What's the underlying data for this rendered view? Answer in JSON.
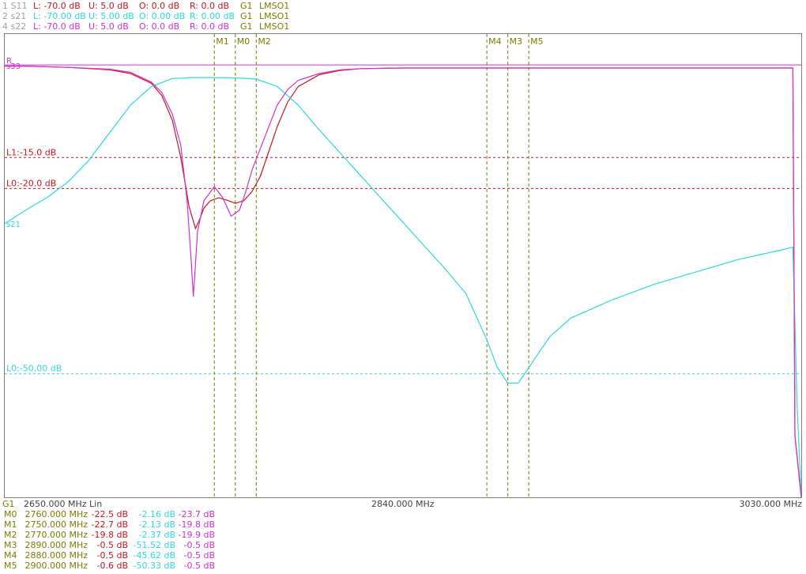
{
  "colors": {
    "s11": "#c8161d",
    "s21": "#33d6d9",
    "s22": "#cc33cc",
    "olive": "#7b7b00",
    "dim": "#a0a0a0",
    "axis_text": "#404040"
  },
  "header_rows": [
    {
      "id": "1 S11",
      "L": "L: -70.0 dB",
      "U": "U:  5.0 dB",
      "O": "O:  0.0 dB",
      "R": "R:  0.0 dB",
      "G": "G1",
      "lms": "LMSO1",
      "color": "#c8161d"
    },
    {
      "id": "2 s21",
      "L": "L: -70.00 dB",
      "U": "U:  5.00 dB",
      "O": "O:  0.00 dB",
      "R": "R:  0.00 dB",
      "G": "G1",
      "lms": "LMSO1",
      "color": "#33d6d9"
    },
    {
      "id": "4 s22",
      "L": "L: -70.0 dB",
      "U": "U:  5.0 dB",
      "O": "O:  0.0 dB",
      "R": "R:  0.0 dB",
      "G": "G1",
      "lms": "LMSO1",
      "color": "#cc33cc"
    }
  ],
  "plot_labels": {
    "ref_r": "R",
    "ref_s": "s33",
    "trace_label_s21": "s21"
  },
  "limit_lines": [
    {
      "label": "L1:-15.0 dB",
      "value_db": -15.0,
      "trace": "s11"
    },
    {
      "label": "L0:-20.0 dB",
      "value_db": -20.0,
      "trace": "s11"
    },
    {
      "label": "L0:-50.00 dB",
      "value_db": -50.0,
      "trace": "s21"
    }
  ],
  "x_axis": {
    "gate": "G1",
    "start_label": "2650.000 MHz Lin",
    "center_label": "2840.000 MHz",
    "stop_label": "3030.000 MHz",
    "start_mhz": 2650,
    "stop_mhz": 3030
  },
  "marker_table": [
    {
      "name": "M0",
      "freq": "2760.000 MHz",
      "s11": "-22.5 dB",
      "s21": "-2.16  dB",
      "s22": "-23.7 dB"
    },
    {
      "name": "M1",
      "freq": "2750.000 MHz",
      "s11": "-22.7 dB",
      "s21": "-2.13  dB",
      "s22": "-19.8 dB"
    },
    {
      "name": "M2",
      "freq": "2770.000 MHz",
      "s11": "-19.8 dB",
      "s21": "-2.37  dB",
      "s22": "-19.9 dB"
    },
    {
      "name": "M3",
      "freq": "2890.000 MHz",
      "s11": "-0.5 dB",
      "s21": "-51.52  dB",
      "s22": "-0.5 dB"
    },
    {
      "name": "M4",
      "freq": "2880.000 MHz",
      "s11": "-0.5 dB",
      "s21": "-45.62  dB",
      "s22": "-0.5 dB"
    },
    {
      "name": "M5",
      "freq": "2900.000 MHz",
      "s11": "-0.6 dB",
      "s21": "-50.33  dB",
      "s22": "-0.5 dB"
    }
  ],
  "chart_data": {
    "type": "line",
    "x_unit": "MHz",
    "xlim": [
      2650,
      3030
    ],
    "ylim_s11": [
      -70,
      5
    ],
    "ylim_s21": [
      -70,
      5
    ],
    "markers": [
      {
        "name": "M1",
        "x": 2750
      },
      {
        "name": "M0",
        "x": 2760
      },
      {
        "name": "M2",
        "x": 2770
      },
      {
        "name": "M4",
        "x": 2880
      },
      {
        "name": "M3",
        "x": 2890
      },
      {
        "name": "M5",
        "x": 2900
      }
    ],
    "series": [
      {
        "name": "S11",
        "color": "#c8161d",
        "x": [
          2650,
          2660,
          2680,
          2700,
          2710,
          2720,
          2725,
          2730,
          2734,
          2738,
          2741,
          2743,
          2745,
          2748,
          2752,
          2756,
          2760,
          2764,
          2768,
          2772,
          2776,
          2780,
          2785,
          2790,
          2800,
          2810,
          2820,
          2840,
          2880,
          2950,
          3000,
          3026,
          3027,
          3030
        ],
        "y": [
          -0.2,
          -0.2,
          -0.4,
          -0.8,
          -1.4,
          -3.0,
          -5.0,
          -9.0,
          -15.0,
          -23.0,
          -26.5,
          -25.0,
          -23.2,
          -22.0,
          -21.5,
          -21.9,
          -22.4,
          -22.0,
          -20.5,
          -18.0,
          -14.0,
          -10.0,
          -6.0,
          -3.5,
          -1.6,
          -0.9,
          -0.6,
          -0.5,
          -0.5,
          -0.5,
          -0.5,
          -0.5,
          -60.0,
          -70.0
        ]
      },
      {
        "name": "s21",
        "color": "#33d6d9",
        "x": [
          2650,
          2660,
          2670,
          2680,
          2690,
          2700,
          2710,
          2720,
          2730,
          2740,
          2750,
          2760,
          2770,
          2780,
          2790,
          2800,
          2820,
          2840,
          2860,
          2870,
          2880,
          2885,
          2890,
          2895,
          2900,
          2910,
          2920,
          2940,
          2960,
          2980,
          3000,
          3020,
          3026,
          3028,
          3030
        ],
        "y": [
          -25.7,
          -23.5,
          -21.5,
          -19.0,
          -15.5,
          -11.0,
          -6.5,
          -3.5,
          -2.2,
          -2.05,
          -2.05,
          -2.1,
          -2.3,
          -3.5,
          -6.5,
          -10.5,
          -18.0,
          -25.5,
          -33.0,
          -37.0,
          -44.5,
          -49.0,
          -51.5,
          -51.5,
          -49.0,
          -44.0,
          -41.0,
          -38.0,
          -35.5,
          -33.5,
          -31.5,
          -30.0,
          -29.5,
          -55.0,
          -70.0
        ]
      },
      {
        "name": "s22",
        "color": "#cc33cc",
        "x": [
          2650,
          2660,
          2680,
          2700,
          2710,
          2720,
          2725,
          2730,
          2734,
          2737,
          2739,
          2740,
          2742,
          2745,
          2750,
          2754,
          2758,
          2762,
          2765,
          2768,
          2772,
          2776,
          2780,
          2785,
          2790,
          2800,
          2810,
          2820,
          2840,
          2880,
          2950,
          3000,
          3026,
          3027,
          3030
        ],
        "y": [
          -0.2,
          -0.2,
          -0.4,
          -0.7,
          -1.2,
          -2.8,
          -4.5,
          -8.0,
          -13.0,
          -22.0,
          -32.0,
          -37.5,
          -27.0,
          -22.0,
          -19.7,
          -21.5,
          -24.5,
          -23.5,
          -20.5,
          -17.0,
          -13.5,
          -10.0,
          -6.5,
          -4.0,
          -2.5,
          -1.4,
          -0.8,
          -0.6,
          -0.5,
          -0.5,
          -0.5,
          -0.5,
          -0.5,
          -60.0,
          -70.0
        ]
      }
    ]
  }
}
